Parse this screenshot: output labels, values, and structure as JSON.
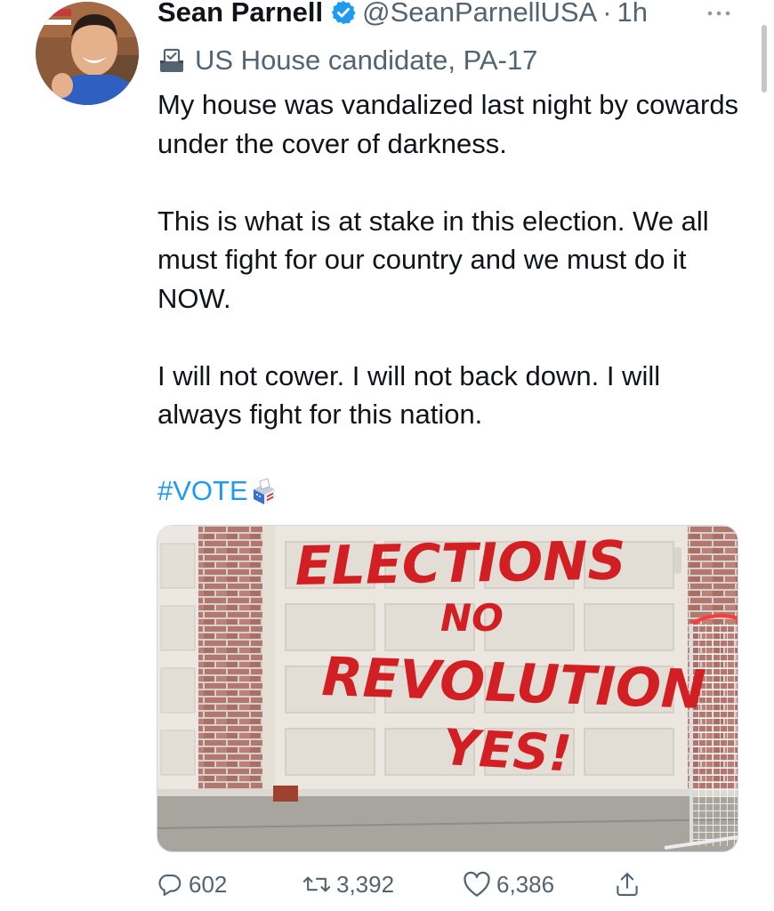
{
  "tweet": {
    "author_name": "Sean Parnell",
    "handle": "@SeanParnellUSA",
    "separator": "·",
    "time": "1h",
    "label": "US House candidate, PA-17",
    "paragraphs": [
      "My house was vandalized last night by cowards under the cover of darkness.",
      "This is what is at stake in this election. We all must fight for our country and we must do it NOW.",
      "I will not cower. I will not back down. I will always fight for this nation."
    ],
    "hashtag": "#VOTE",
    "image_text": {
      "line1": "ELECTIONS",
      "line2": "NO",
      "line3": "REVOLUTION",
      "line4": "YES!"
    },
    "stats": {
      "replies": "602",
      "retweets": "3,392",
      "likes": "6,386"
    }
  },
  "colors": {
    "primary_text": "#0f1419",
    "secondary_text": "#536471",
    "link": "#1d9bf0",
    "verified_badge": "#1d9bf0",
    "graffiti": "#d21f24"
  },
  "icons": {
    "verified": "verified-badge-icon",
    "label": "ballot-box-icon",
    "reply": "reply-icon",
    "retweet": "retweet-icon",
    "like": "heart-icon",
    "share": "share-icon",
    "more": "more-icon"
  }
}
